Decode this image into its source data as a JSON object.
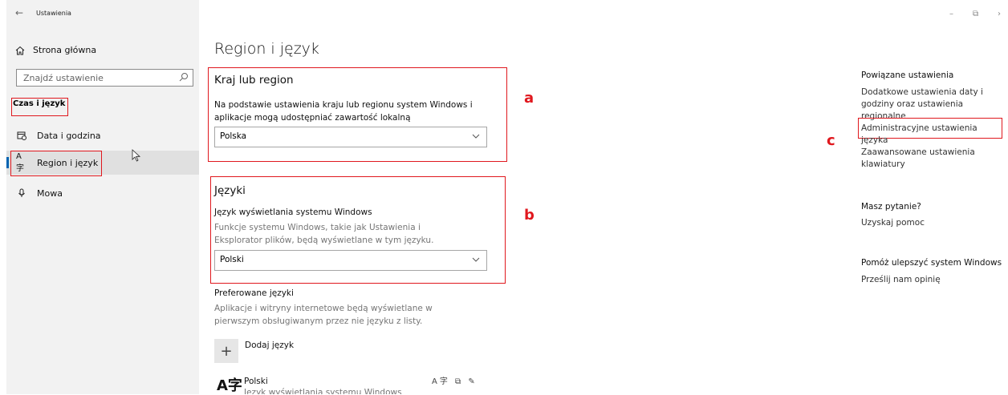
{
  "window": {
    "title": "Ustawienia",
    "minimize": "–",
    "restore": "⧉",
    "close_partial": "›"
  },
  "sidebar": {
    "home_label": "Strona główna",
    "search_placeholder": "Znajdź ustawienie",
    "section_title": "Czas i język",
    "items": [
      {
        "label": "Data i godzina",
        "icon": "calendar-clock-icon"
      },
      {
        "label": "Region i język",
        "icon": "language-icon",
        "active": true
      },
      {
        "label": "Mowa",
        "icon": "microphone-icon"
      }
    ]
  },
  "main": {
    "page_title": "Region i język",
    "country": {
      "heading": "Kraj lub region",
      "description": "Na podstawie ustawienia kraju lub regionu system Windows i aplikacje mogą udostępniać zawartość lokalną",
      "selected": "Polska"
    },
    "languages": {
      "heading": "Języki",
      "display_label": "Język wyświetlania systemu Windows",
      "display_description": "Funkcje systemu Windows, takie jak Ustawienia i Eksplorator plików, będą wyświetlane w tym języku.",
      "selected": "Polski",
      "preferred_label": "Preferowane języki",
      "preferred_description": "Aplikacje i witryny internetowe będą wyświetlane w pierwszym obsługiwanym przez nie języku z listy.",
      "add_label": "Dodaj język",
      "list": [
        {
          "name": "Polski",
          "sub": "Język wyświetlania systemu Windows"
        }
      ]
    }
  },
  "related": {
    "heading": "Powiązane ustawienia",
    "links": [
      "Dodatkowe ustawienia daty i godziny oraz ustawienia regionalne",
      "Administracyjne ustawienia języka",
      "Zaawansowane ustawienia klawiatury"
    ],
    "question_heading": "Masz pytanie?",
    "help_link": "Uzyskaj pomoc",
    "improve_heading": "Pomóż ulepszyć system Windows",
    "feedback_link": "Prześlij nam opinię"
  },
  "annotations": {
    "a": "a",
    "b": "b",
    "c": "c",
    "color": "#e0181e"
  }
}
